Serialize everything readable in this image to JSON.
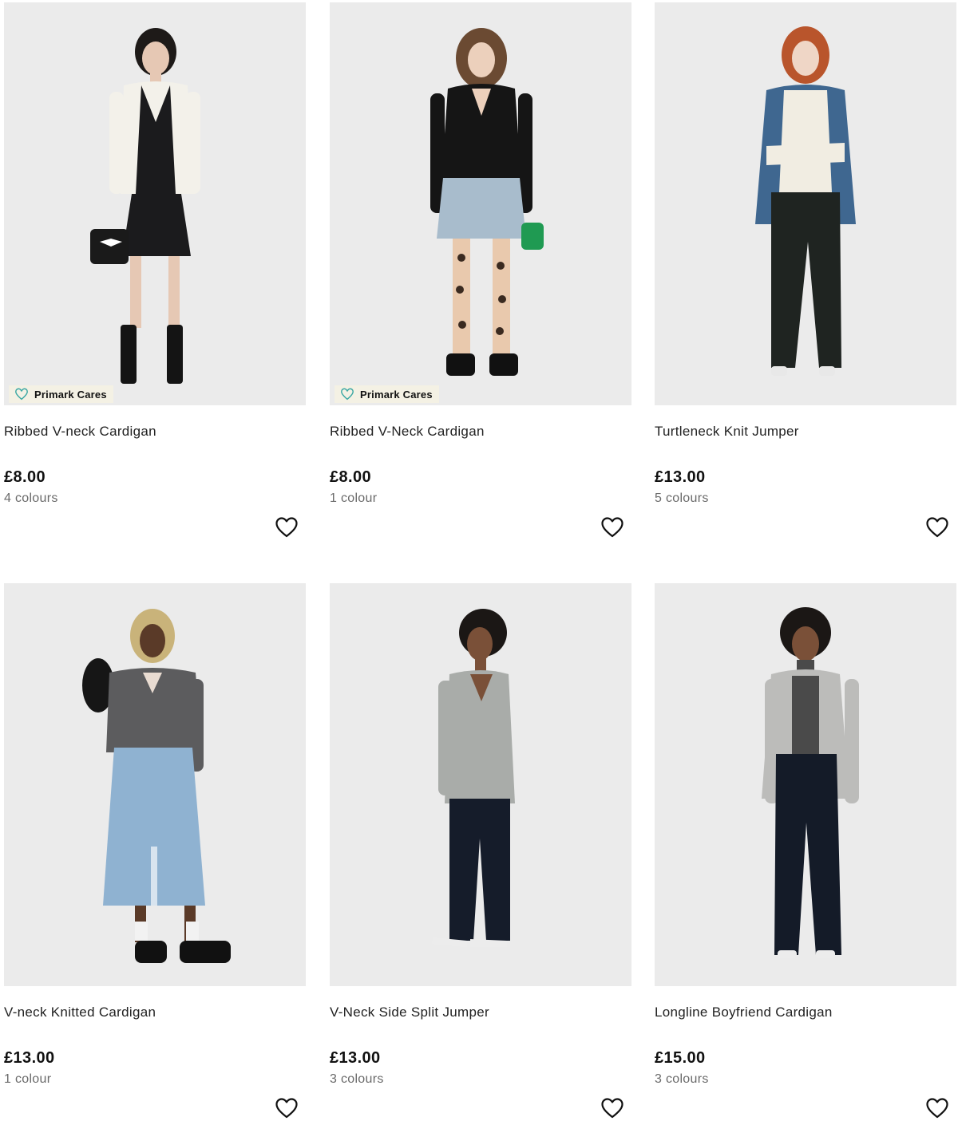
{
  "badge_label": "Primark Cares",
  "colors": {
    "photo_bg": "#ebebeb",
    "badge_bg": "#f4f1e4",
    "badge_icon": "#3aa7a3",
    "price": "#111111",
    "muted": "#6a6a6a"
  },
  "products": [
    {
      "title": "Ribbed V-neck Cardigan",
      "price": "£8.00",
      "colours": "4 colours",
      "badge": true
    },
    {
      "title": "Ribbed V-Neck Cardigan",
      "price": "£8.00",
      "colours": "1 colour",
      "badge": true
    },
    {
      "title": "Turtleneck Knit Jumper",
      "price": "£13.00",
      "colours": "5 colours",
      "badge": false
    },
    {
      "title": "V-neck Knitted Cardigan",
      "price": "£13.00",
      "colours": "1 colour",
      "badge": false
    },
    {
      "title": "V-Neck Side Split Jumper",
      "price": "£13.00",
      "colours": "3 colours",
      "badge": false
    },
    {
      "title": "Longline Boyfriend Cardigan",
      "price": "£15.00",
      "colours": "3 colours",
      "badge": false
    }
  ],
  "icons": {
    "wishlist": "heart-outline-icon",
    "badge": "heart-badge-icon"
  }
}
